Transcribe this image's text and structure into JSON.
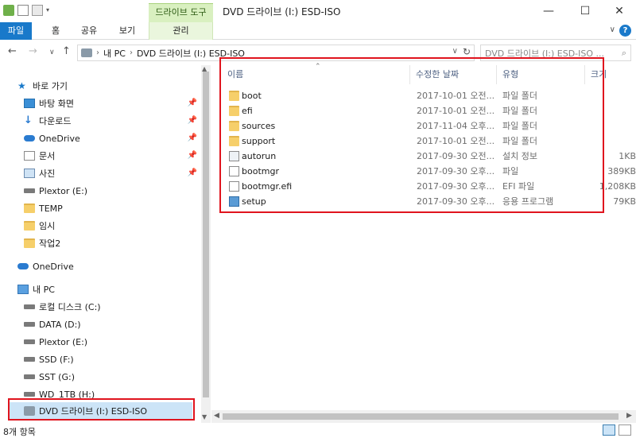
{
  "window": {
    "context_tab_header": "드라이브 도구",
    "title": "DVD 드라이브 (I:) ESD-ISO",
    "controls": {
      "minimize": "—",
      "maximize": "☐",
      "close": "✕"
    }
  },
  "ribbon": {
    "tabs": [
      {
        "label": "파일"
      },
      {
        "label": "홈"
      },
      {
        "label": "공유"
      },
      {
        "label": "보기"
      },
      {
        "label": "관리"
      }
    ]
  },
  "address": {
    "breadcrumb": [
      "내 PC",
      "DVD 드라이브 (I:) ESD-ISO"
    ],
    "search_placeholder": "DVD 드라이브 (I:) ESD-ISO ..."
  },
  "nav": {
    "items": [
      {
        "label": "바로 가기",
        "icon": "star-icon",
        "pinned": false
      },
      {
        "label": "바탕 화면",
        "icon": "desktop-icon",
        "pinned": true
      },
      {
        "label": "다운로드",
        "icon": "download-icon",
        "pinned": true
      },
      {
        "label": "OneDrive",
        "icon": "cloud-icon",
        "pinned": true
      },
      {
        "label": "문서",
        "icon": "document-icon",
        "pinned": true
      },
      {
        "label": "사진",
        "icon": "picture-icon",
        "pinned": true
      },
      {
        "label": "Plextor (E:)",
        "icon": "drive-icon",
        "pinned": false
      },
      {
        "label": "TEMP",
        "icon": "folder-icon",
        "pinned": false
      },
      {
        "label": "임시",
        "icon": "folder-icon",
        "pinned": false
      },
      {
        "label": "작업2",
        "icon": "folder-icon",
        "pinned": false
      },
      {
        "label": "OneDrive",
        "icon": "cloud-icon",
        "pinned": false
      },
      {
        "label": "내 PC",
        "icon": "computer-icon",
        "pinned": false
      },
      {
        "label": "로컬 디스크 (C:)",
        "icon": "drive-icon",
        "pinned": false
      },
      {
        "label": "DATA (D:)",
        "icon": "drive-icon",
        "pinned": false
      },
      {
        "label": "Plextor (E:)",
        "icon": "drive-icon",
        "pinned": false
      },
      {
        "label": "SSD (F:)",
        "icon": "drive-icon",
        "pinned": false
      },
      {
        "label": "SST (G:)",
        "icon": "drive-icon",
        "pinned": false
      },
      {
        "label": "WD_1TB (H:)",
        "icon": "drive-icon",
        "pinned": false
      },
      {
        "label": "DVD 드라이브 (I:) ESD-ISO",
        "icon": "dvd-drive-icon",
        "pinned": false,
        "selected": true
      }
    ]
  },
  "columns": {
    "name": "이름",
    "date": "수정한 날짜",
    "type": "유형",
    "size": "크기"
  },
  "files": [
    {
      "name": "boot",
      "date": "2017-10-01 오전...",
      "type": "파일 폴더",
      "size": "",
      "icon": "folder-icon"
    },
    {
      "name": "efi",
      "date": "2017-10-01 오전...",
      "type": "파일 폴더",
      "size": "",
      "icon": "folder-icon"
    },
    {
      "name": "sources",
      "date": "2017-11-04 오후...",
      "type": "파일 폴더",
      "size": "",
      "icon": "folder-icon"
    },
    {
      "name": "support",
      "date": "2017-10-01 오전...",
      "type": "파일 폴더",
      "size": "",
      "icon": "folder-icon"
    },
    {
      "name": "autorun",
      "date": "2017-09-30 오전...",
      "type": "설치 정보",
      "size": "1KB",
      "icon": "settings-file-icon"
    },
    {
      "name": "bootmgr",
      "date": "2017-09-30 오후...",
      "type": "파일",
      "size": "389KB",
      "icon": "file-icon"
    },
    {
      "name": "bootmgr.efi",
      "date": "2017-09-30 오후...",
      "type": "EFI 파일",
      "size": "1,208KB",
      "icon": "file-icon"
    },
    {
      "name": "setup",
      "date": "2017-09-30 오후...",
      "type": "응용 프로그램",
      "size": "79KB",
      "icon": "setup-app-icon"
    }
  ],
  "status": {
    "item_count": "8개 항목"
  },
  "colors": {
    "accent": "#1979ca",
    "highlight_red": "#e0141e",
    "context_tab": "#d9f0c0"
  }
}
